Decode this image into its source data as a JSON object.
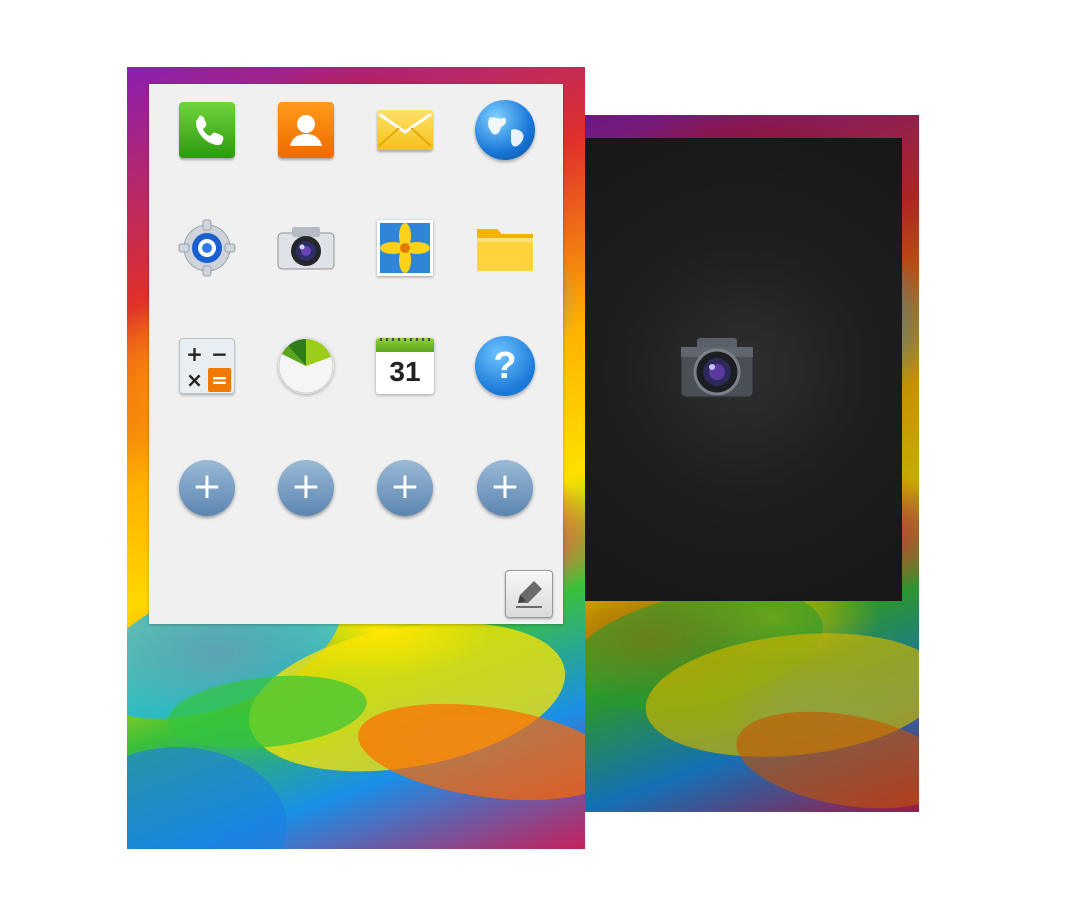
{
  "panel": {
    "apps": [
      {
        "name": "Phone",
        "icon": "phone-icon"
      },
      {
        "name": "Contacts",
        "icon": "contacts-icon"
      },
      {
        "name": "Messages",
        "icon": "mail-icon"
      },
      {
        "name": "Internet",
        "icon": "globe-icon"
      },
      {
        "name": "Settings",
        "icon": "settings-icon"
      },
      {
        "name": "Camera",
        "icon": "camera-icon"
      },
      {
        "name": "Gallery",
        "icon": "gallery-icon"
      },
      {
        "name": "My Files",
        "icon": "folder-icon"
      },
      {
        "name": "Calculator",
        "icon": "calculator-icon"
      },
      {
        "name": "Storage",
        "icon": "pie-chart-icon"
      },
      {
        "name": "Calendar",
        "icon": "calendar-icon"
      },
      {
        "name": "Help",
        "icon": "help-icon"
      }
    ],
    "calendar_day": "31",
    "help_glyph": "?",
    "calc_keys": [
      "+",
      "−",
      "×",
      "="
    ],
    "add_slot_glyph": "+",
    "add_slots": 4,
    "edit_icon": "pencil-icon"
  },
  "preview": {
    "icon": "camera-icon"
  },
  "colors": {
    "panel_bg": "#f0f0f0",
    "dark_screen": "#1e1e1e",
    "add_button": "#6e94bb"
  }
}
